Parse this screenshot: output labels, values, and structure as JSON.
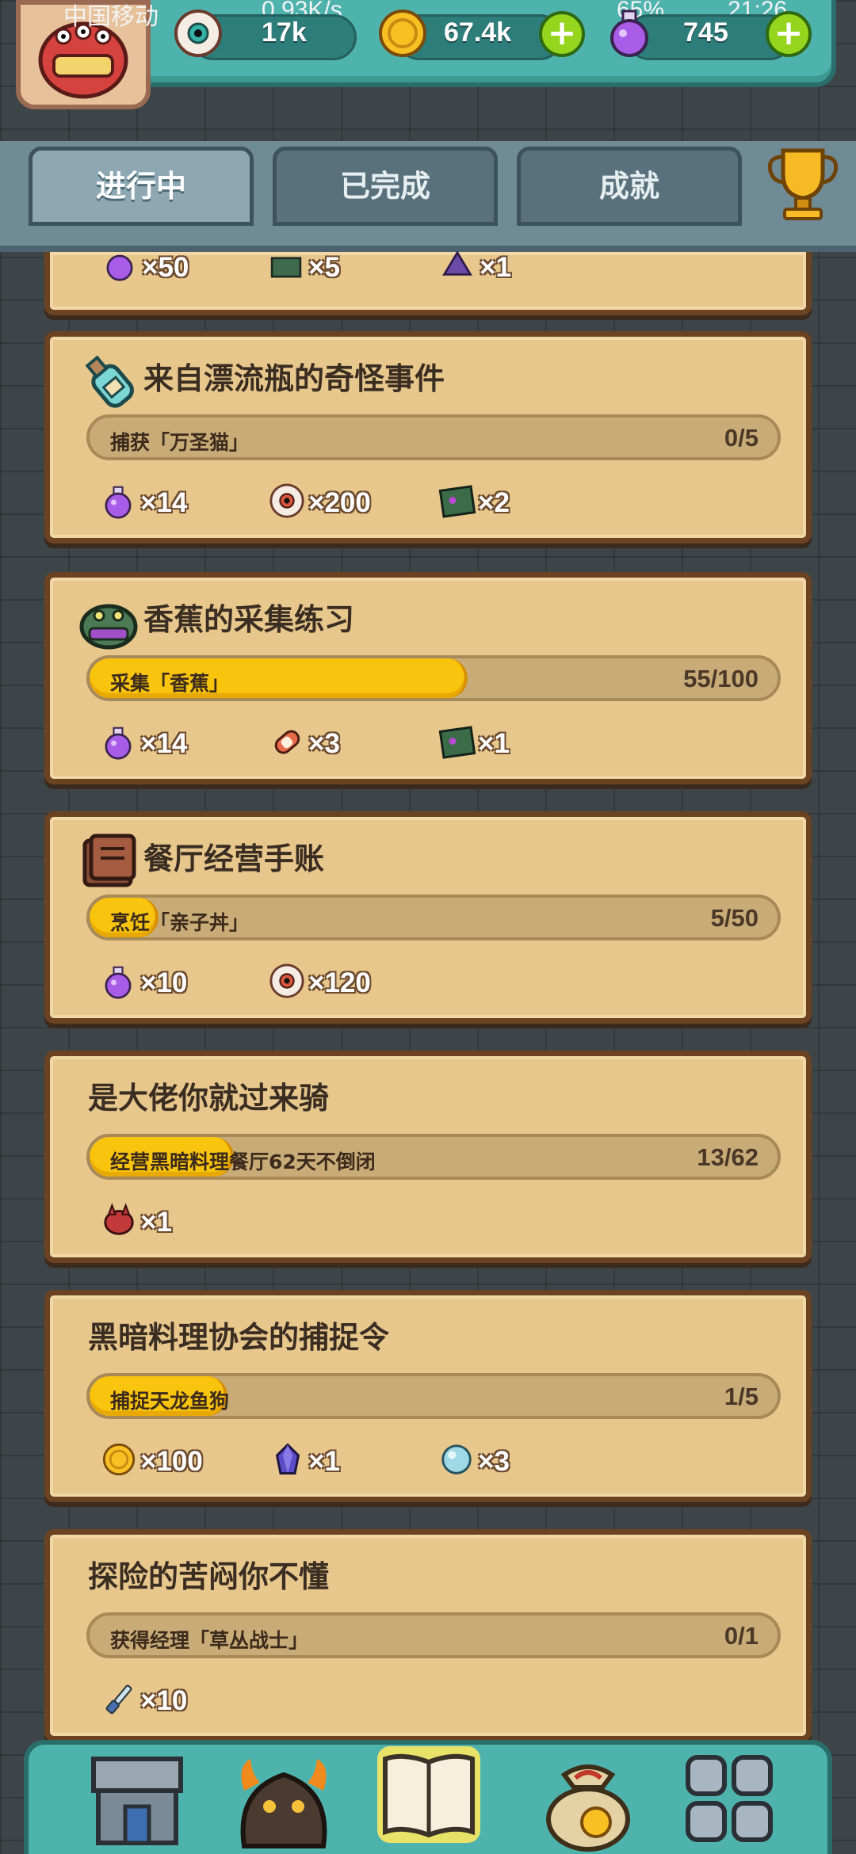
{
  "status_bar": {
    "carrier": "中国移动",
    "speed": "0.93K/s",
    "battery": "65%",
    "time": "21:26"
  },
  "resources": [
    {
      "icon": "eyeball-icon",
      "value": "17k"
    },
    {
      "icon": "gold-coin-icon",
      "value": "67.4k"
    },
    {
      "icon": "purple-potion-icon",
      "value": "745"
    }
  ],
  "tabs": [
    {
      "label": "进行中",
      "active": true
    },
    {
      "label": "已完成",
      "active": false
    },
    {
      "label": "成就",
      "active": false
    }
  ],
  "partial_card_rewards": [
    {
      "icon": "purple-potion-icon",
      "count": "×50"
    },
    {
      "icon": "chest-icon",
      "count": "×5"
    },
    {
      "icon": "gem-icon",
      "count": "×1"
    }
  ],
  "quests": [
    {
      "title": "来自漂流瓶的奇怪事件",
      "icon": "bottle-icon",
      "progress_label": "捕获「万圣猫」",
      "progress_count": "0/5",
      "progress_fraction": 0,
      "rewards": [
        {
          "icon": "purple-potion-icon",
          "count": "×14"
        },
        {
          "icon": "eyeball-icon",
          "count": "×200"
        },
        {
          "icon": "map-card-icon",
          "count": "×2"
        }
      ]
    },
    {
      "title": "香蕉的采集练习",
      "icon": "monster-icon",
      "progress_label": "采集「香蕉」",
      "progress_count": "55/100",
      "progress_fraction": 0.55,
      "rewards": [
        {
          "icon": "purple-potion-icon",
          "count": "×14"
        },
        {
          "icon": "meat-icon",
          "count": "×3"
        },
        {
          "icon": "map-card-icon",
          "count": "×1"
        }
      ]
    },
    {
      "title": "餐厅经营手账",
      "icon": "book-icon",
      "progress_label": "烹饪「亲子丼」",
      "progress_count": "5/50",
      "progress_fraction": 0.1,
      "rewards": [
        {
          "icon": "purple-potion-icon",
          "count": "×10"
        },
        {
          "icon": "eyeball-icon",
          "count": "×120"
        }
      ]
    },
    {
      "title": "是大佬你就过来骑",
      "icon": "",
      "progress_label": "经营黑暗料理餐厅62天不倒闭",
      "progress_count": "13/62",
      "progress_fraction": 0.21,
      "rewards": [
        {
          "icon": "red-creature-icon",
          "count": "×1"
        }
      ]
    },
    {
      "title": "黑暗料理协会的捕捉令",
      "icon": "",
      "progress_label": "捕捉天龙鱼狗",
      "progress_count": "1/5",
      "progress_fraction": 0.2,
      "rewards": [
        {
          "icon": "gold-coin-icon",
          "count": "×100"
        },
        {
          "icon": "crystal-icon",
          "count": "×1"
        },
        {
          "icon": "blue-orb-icon",
          "count": "×3"
        }
      ]
    },
    {
      "title": "探险的苦闷你不懂",
      "icon": "",
      "progress_label": "获得经理「草丛战士」",
      "progress_count": "0/1",
      "progress_fraction": 0,
      "rewards": [
        {
          "icon": "knife-icon",
          "count": "×10"
        }
      ]
    }
  ],
  "bottom_nav": [
    {
      "icon": "restaurant-icon"
    },
    {
      "icon": "monster-lair-icon"
    },
    {
      "icon": "quest-book-icon",
      "active": true
    },
    {
      "icon": "money-bag-icon"
    },
    {
      "icon": "grid-menu-icon"
    }
  ],
  "colors": {
    "accent_teal": "#4fb3ad",
    "card_parchment": "#e8c78c",
    "progress_yellow": "#f9c40d",
    "plus_green": "#95d51e"
  }
}
